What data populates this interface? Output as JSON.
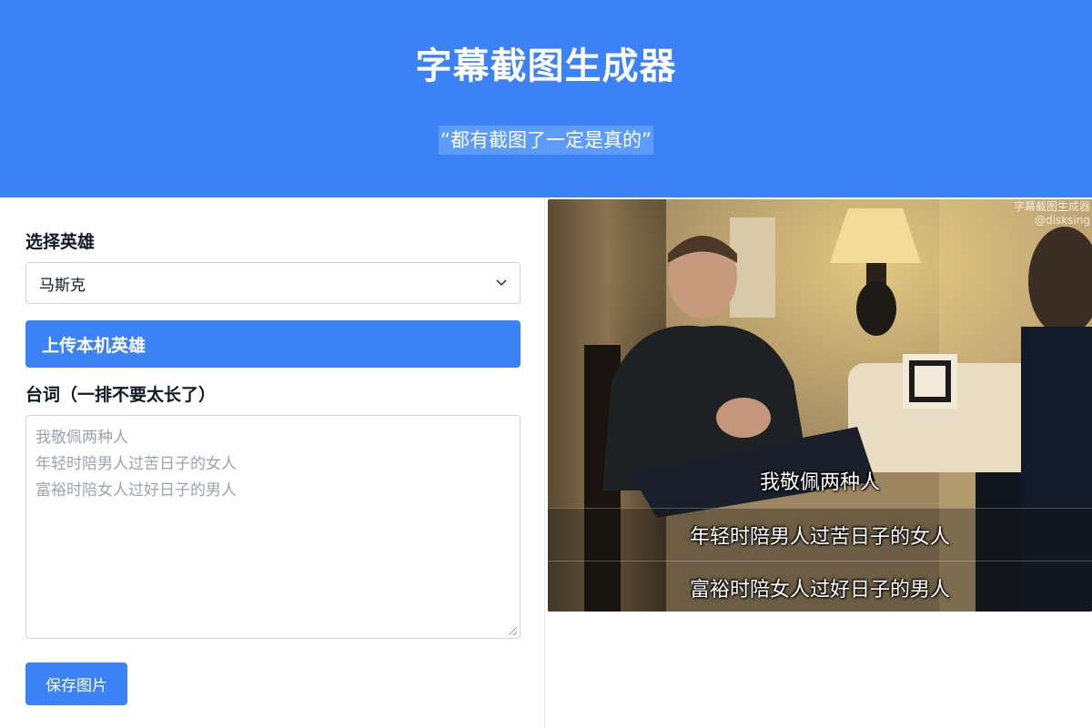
{
  "header": {
    "title": "字幕截图生成器",
    "subtitle": "“都有截图了一定是真的”"
  },
  "form": {
    "hero_label": "选择英雄",
    "hero_selected": "马斯克",
    "upload_label": "上传本机英雄",
    "lines_label": "台词（一排不要太长了）",
    "lines_placeholder": [
      "我敬佩两种人",
      "年轻时陪男人过苦日子的女人",
      "富裕时陪女人过好日子的男人"
    ],
    "save_label": "保存图片"
  },
  "preview": {
    "watermark_title": "字幕截图生成器",
    "watermark_handle": "@disksing",
    "subtitles": [
      "我敬佩两种人",
      "年轻时陪男人过苦日子的女人",
      "富裕时陪女人过好日子的男人"
    ]
  },
  "colors": {
    "primary": "#3b82f6",
    "header_bg": "#3b82f6",
    "border": "#d1d5db",
    "placeholder": "#9ca3af"
  }
}
